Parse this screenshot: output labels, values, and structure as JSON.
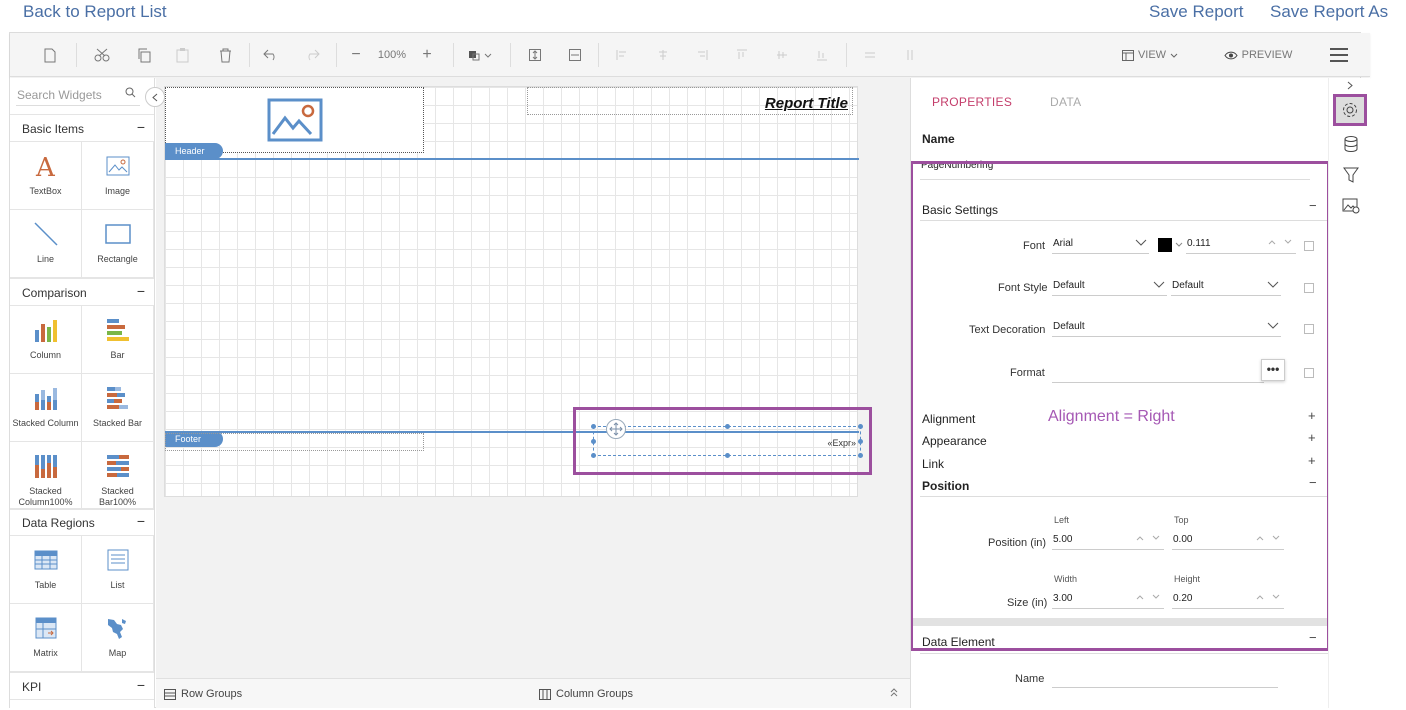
{
  "links": {
    "back": "Back to Report List",
    "save": "Save Report",
    "save_as": "Save Report As"
  },
  "toolbar": {
    "zoom": "100%",
    "view": "VIEW",
    "preview": "PREVIEW"
  },
  "widgets": {
    "search_placeholder": "Search Widgets",
    "categories": {
      "basic": {
        "label": "Basic Items",
        "toggle": "−"
      },
      "comparison": {
        "label": "Comparison",
        "toggle": "−"
      },
      "data_regions": {
        "label": "Data Regions",
        "toggle": "−"
      },
      "kpi": {
        "label": "KPI",
        "toggle": "−"
      }
    },
    "items": {
      "textbox": "TextBox",
      "image": "Image",
      "line": "Line",
      "rectangle": "Rectangle",
      "column": "Column",
      "bar": "Bar",
      "stacked_column": "Stacked Column",
      "stacked_bar": "Stacked Bar",
      "stacked_column100": "Stacked Column100%",
      "stacked_bar100": "Stacked Bar100%",
      "table": "Table",
      "list": "List",
      "matrix": "Matrix",
      "map": "Map"
    }
  },
  "canvas": {
    "header_tag": "Header",
    "footer_tag": "Footer",
    "report_title": "Report Title",
    "expr": "«Expr»"
  },
  "groups": {
    "row": "Row Groups",
    "column": "Column Groups"
  },
  "props": {
    "tabs": {
      "properties": "PROPERTIES",
      "data": "DATA"
    },
    "name_label": "Name",
    "name_value": "PageNumbering",
    "basic_settings": "Basic Settings",
    "font_label": "Font",
    "font_value": "Arial",
    "font_size": "0.111",
    "font_style_label": "Font Style",
    "font_style_value": "Default",
    "font_weight_value": "Default",
    "text_decoration_label": "Text Decoration",
    "text_decoration_value": "Default",
    "format_label": "Format",
    "format_button": "•••",
    "alignment": "Alignment",
    "appearance": "Appearance",
    "link": "Link",
    "position": "Position",
    "plus": "+",
    "minus": "−",
    "left_label": "Left",
    "top_label": "Top",
    "position_label": "Position (in)",
    "left_value": "5.00",
    "top_value": "0.00",
    "width_label": "Width",
    "height_label": "Height",
    "size_label": "Size (in)",
    "width_value": "3.00",
    "height_value": "0.20",
    "data_element": "Data Element",
    "de_name_label": "Name"
  },
  "annotation": "Alignment = Right",
  "colors": {
    "accent": "#c43d6b",
    "annotation": "#9c4f9e",
    "section": "#5b8fc9",
    "link": "#4a6fa5"
  }
}
